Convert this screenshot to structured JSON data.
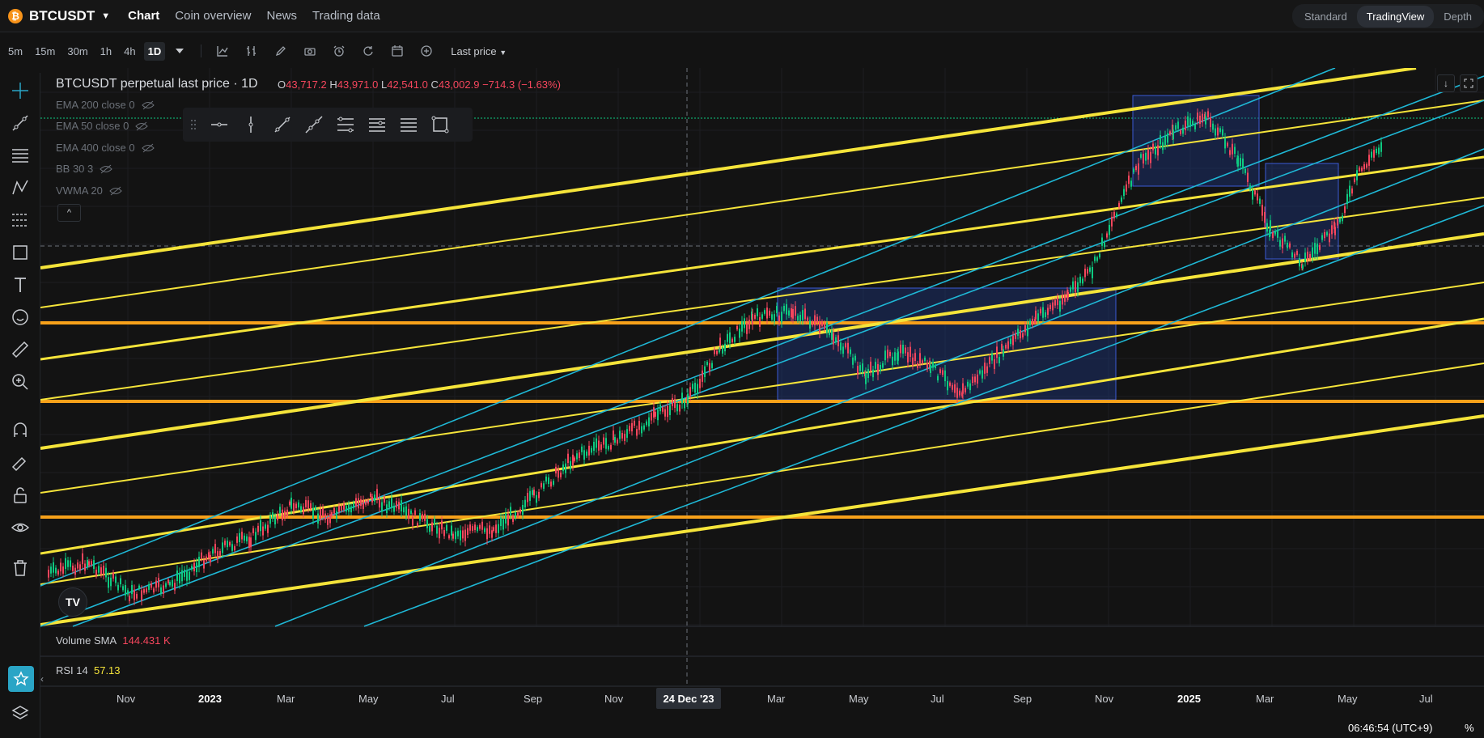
{
  "header": {
    "symbol": "BTCUSDT",
    "coin_icon": "bitcoin-icon",
    "tabs": [
      {
        "label": "Chart",
        "active": true
      },
      {
        "label": "Coin overview",
        "active": false
      },
      {
        "label": "News",
        "active": false
      },
      {
        "label": "Trading data",
        "active": false
      }
    ],
    "modes": [
      {
        "label": "Standard",
        "active": false
      },
      {
        "label": "TradingView",
        "active": true
      },
      {
        "label": "Depth",
        "active": false
      }
    ]
  },
  "toolbar": {
    "timeframes": [
      "5m",
      "15m",
      "30m",
      "1h",
      "4h",
      "1D"
    ],
    "active_timeframe": "1D",
    "price_type": "Last price"
  },
  "legend": {
    "title": "BTCUSDT perpetual last price · 1D",
    "ohlc": [
      {
        "k": "O",
        "v": "43,717.2"
      },
      {
        "k": "H",
        "v": "43,971.0"
      },
      {
        "k": "L",
        "v": "42,541.0"
      },
      {
        "k": "C",
        "v": "43,002.9"
      }
    ],
    "change": "−714.3 (−1.63%)",
    "indicators": [
      "EMA 200 close 0",
      "EMA 50 close 0",
      "EMA 400 close 0",
      "BB 30 3",
      "VWMA 20"
    ]
  },
  "panes": {
    "volume": {
      "label": "Volume SMA",
      "value": "144.431 K"
    },
    "rsi": {
      "label": "RSI 14",
      "value": "57.13"
    }
  },
  "crosshair_date": "24 Dec '23",
  "time_axis_labels": [
    "Nov",
    "2023",
    "Mar",
    "May",
    "Jul",
    "Sep",
    "Nov",
    "Mar",
    "May",
    "Jul",
    "Sep",
    "Nov",
    "2025",
    "Mar",
    "May",
    "Jul"
  ],
  "clock": "06:46:54 (UTC+9)",
  "percent_toggle": "%",
  "colors": {
    "background": "#131313",
    "up": "#0ecb81",
    "down": "#f6465d",
    "trendline_yellow": "#f5e43a",
    "trendline_cyan": "#1fb8d6",
    "horizontal_orange": "#f7a11a",
    "box_fill": "#1f3a8a",
    "accent": "#2aa5c6"
  }
}
